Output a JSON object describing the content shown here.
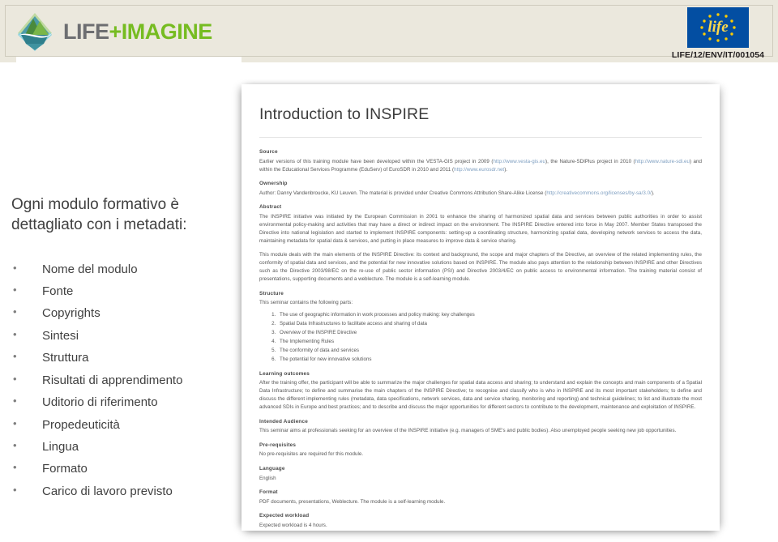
{
  "header": {
    "brand_life": "LIFE",
    "brand_imagine": "+IMAGINE",
    "logo_icon": "life-imagine-diamond-logo",
    "eu_flag_icon": "eu-life-flag",
    "eu_flag_word": "life",
    "project_code": "LIFE/12/ENV/IT/001054",
    "band_color": "#ebe8dd",
    "brand_life_color": "#6d6e71",
    "brand_imagine_color": "#76bc21",
    "flag_color": "#034ea2",
    "star_color": "#ffcc00"
  },
  "left": {
    "heading": "Ogni modulo formativo è dettagliato con i metadati:",
    "bullets": [
      "Nome del modulo",
      "Fonte",
      "Copyrights",
      "Sintesi",
      "Struttura",
      "Risultati di apprendimento",
      "Uditorio di riferimento",
      "Propedeuticità",
      "Lingua",
      "Formato",
      "Carico di lavoro previsto"
    ]
  },
  "document": {
    "title": "Introduction to INSPIRE",
    "sections": {
      "source_heading": "Source",
      "source_text_1": "Earlier versions of this training module have been developed within the VESTA-GIS project in 2009 (",
      "source_link_1": "http://www.vesta-gis.eu",
      "source_text_2": "), the Nature-SDIPlus project in 2010 (",
      "source_link_2": "http://www.nature-sdi.eu",
      "source_text_3": ") and within the Educational Services Programme (EduServ) of EuroSDR in 2010 and 2011 (",
      "source_link_3": "http://www.eurosdr.net",
      "source_text_4": ").",
      "ownership_heading": "Ownership",
      "ownership_text_1": "Author: Danny Vandenbroucke, KU Leuven. The material is provided under Creative Commons Attribution Share-Alike License (",
      "ownership_link": "http://creativecommons.org/licenses/by-sa/3.0/",
      "ownership_text_2": ").",
      "abstract_heading": "Abstract",
      "abstract_p1": "The INSPIRE initiative was initiated by the European Commission in 2001 to enhance the sharing of harmonized spatial data and services between public authorities in order to assist environmental policy-making and activities that may have a direct or indirect impact on the environment. The INSPIRE Directive entered into force in May 2007. Member States transposed the Directive into national legislation and started to implement INSPIRE components: setting-up a coordinating structure, harmonizing spatial data, developing network services to access the data, maintaining metadata for spatial data & services, and putting in place measures to improve data & service sharing.",
      "abstract_p2": "This module deals with the main elements of the INSPIRE Directive: its context and background, the scope and major chapters of the Directive, an overview of the related implementing rules, the conformity of spatial data and services, and the potential for new innovative solutions based on INSPIRE. The module also pays attention to the relationship between INSPIRE and other Directives such as the Directive 2003/98/EC on the re-use of public sector information (PSI) and Directive 2003/4/EC on public access to environmental information. The training material consist of presentations, supporting documents and a weblecture. The module is a self-learning module.",
      "structure_heading": "Structure",
      "structure_intro": "This seminar contains the following parts:",
      "structure_items": [
        "The use of geographic information in work processes and policy making: key challenges",
        "Spatial Data Infrastructures to facilitate access and sharing of data",
        "Overview of the INSPIRE Directive",
        "The Implementing Rules",
        "The conformity of data and services",
        "The potential for new innovative solutions"
      ],
      "learning_heading": "Learning outcomes",
      "learning_text": "After the training offer, the participant will be able to summarize the major challenges for spatial data access and sharing; to understand and explain the concepts and main components of a Spatial Data Infrastructure; to define and summarise the main chapters of the INSPIRE Directive; to recognise and classify who is who in INSPIRE and its most important stakeholders; to define and discuss the different implementing rules (metadata, data specifications, network services, data and service sharing, monitoring and reporting) and technical guidelines; to list and illustrate the most advanced SDIs in Europe and best practices; and to describe and discuss the major opportunities for different sectors to contribute to the development, maintenance and exploitation of INSPIRE.",
      "audience_heading": "Intended Audience",
      "audience_text": "This seminar aims at professionals seeking for an overview of the INSPIRE initiative (e.g. managers of SME's and public bodies). Also unemployed people seeking new job opportunities.",
      "prereq_heading": "Pre-requisites",
      "prereq_text": "No pre-requisites are required for this module.",
      "language_heading": "Language",
      "language_text": "English",
      "format_heading": "Format",
      "format_text": "PDF documents, presentations, Weblecture. The module is a self-learning module.",
      "workload_heading": "Expected workload",
      "workload_text": "Expected workload is 4 hours."
    }
  }
}
